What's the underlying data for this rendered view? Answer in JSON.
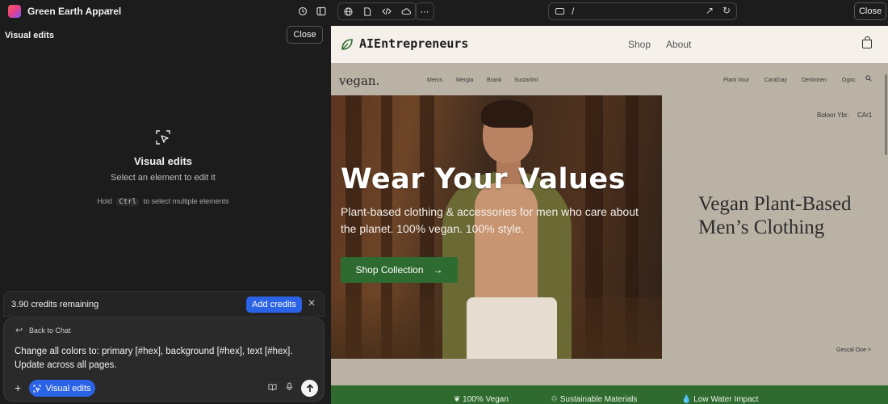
{
  "topbar": {
    "project_name": "Green Earth Apparel",
    "url_path": "/",
    "close_label": "Close"
  },
  "left_panel": {
    "title": "Visual edits",
    "close_label": "Close",
    "empty_title": "Visual edits",
    "empty_subtitle": "Select an element to edit it",
    "hint_before": "Hold",
    "hint_key": "Ctrl",
    "hint_after": "to select multiple elements"
  },
  "credits": {
    "text": "3.90 credits remaining",
    "add_label": "Add credits"
  },
  "chat": {
    "back_label": "Back to Chat",
    "message": "Change all colors to: primary [#hex], background [#hex], text [#hex]. Update across all pages.",
    "visual_edits_chip": "Visual edits"
  },
  "preview": {
    "brand": "AIEntrepreneurs",
    "nav": [
      "Shop",
      "About"
    ],
    "inner_logo": "vegan.",
    "inner_links_left": [
      "Mems",
      "Mergia",
      "Brank",
      "Sustarlmt"
    ],
    "inner_links_right": [
      "Plant Vour",
      "Cantčray",
      "Dertintren",
      "Ognc"
    ],
    "hero_title": "Wear Your Values",
    "hero_subtitle": "Plant-based clothing & accessories for men who care about the planet. 100% vegan. 100% style.",
    "hero_button": "Shop Collection",
    "side_top_left": "Boloor Ybr.",
    "side_top_right": "CAr1",
    "side_title": "Vegan Plant-Based Men’s Clothing",
    "side_link": "Gescal Ooe >",
    "features": [
      "100% Vegan",
      "Sustainable Materials",
      "Low Water Impact"
    ]
  },
  "colors": {
    "accent_blue": "#2b63e6",
    "green_primary": "#2e6b30",
    "nav_bg": "#f5f1ea"
  }
}
